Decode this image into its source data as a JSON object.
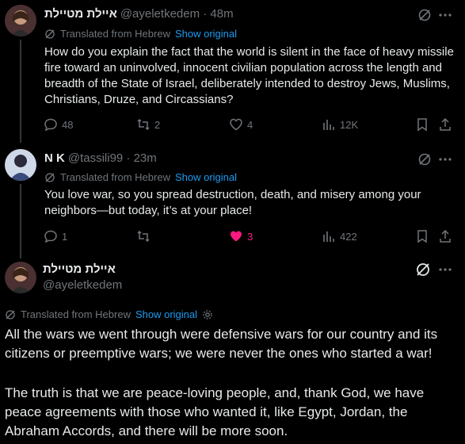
{
  "colors": {
    "accent": "#1d9bf0",
    "like": "#f91880",
    "muted": "#71767b",
    "text": "#e7e9ea"
  },
  "tweet1": {
    "name": "איילת מטיילת",
    "handle_time": "@ayeletkedem · 48m",
    "translated": "Translated from Hebrew",
    "show_original": "Show original",
    "text": "How do you explain the fact that the world is silent in the face of heavy missile fire toward an uninvolved, innocent civilian population across the length and breadth of the State of Israel, deliberately intended to destroy Jews, Muslims, Christians, Druze, and Circassians?",
    "replies": "48",
    "reposts": "2",
    "likes": "4",
    "views": "12K"
  },
  "tweet2": {
    "name": "N K",
    "handle_time": "@tassili99 · 23m",
    "translated": "Translated from Hebrew",
    "show_original": "Show original",
    "text": "You love war, so you spread destruction, death, and misery among your neighbors—but today, it’s at your place!",
    "replies": "1",
    "reposts": "",
    "likes": "3",
    "views": "422"
  },
  "tweet3": {
    "name": "איילת מטיילת",
    "handle": "@ayeletkedem",
    "translated": "Translated from Hebrew",
    "show_original": "Show original",
    "para1": "All the wars we went through were defensive wars for our country and its citizens or preemptive wars; we were never the ones who started a war!",
    "para2": "The truth is that we are peace-loving people, and, thank God, we have peace agreements with those who wanted it, like Egypt, Jordan, the Abraham Accords, and there will be more soon."
  }
}
